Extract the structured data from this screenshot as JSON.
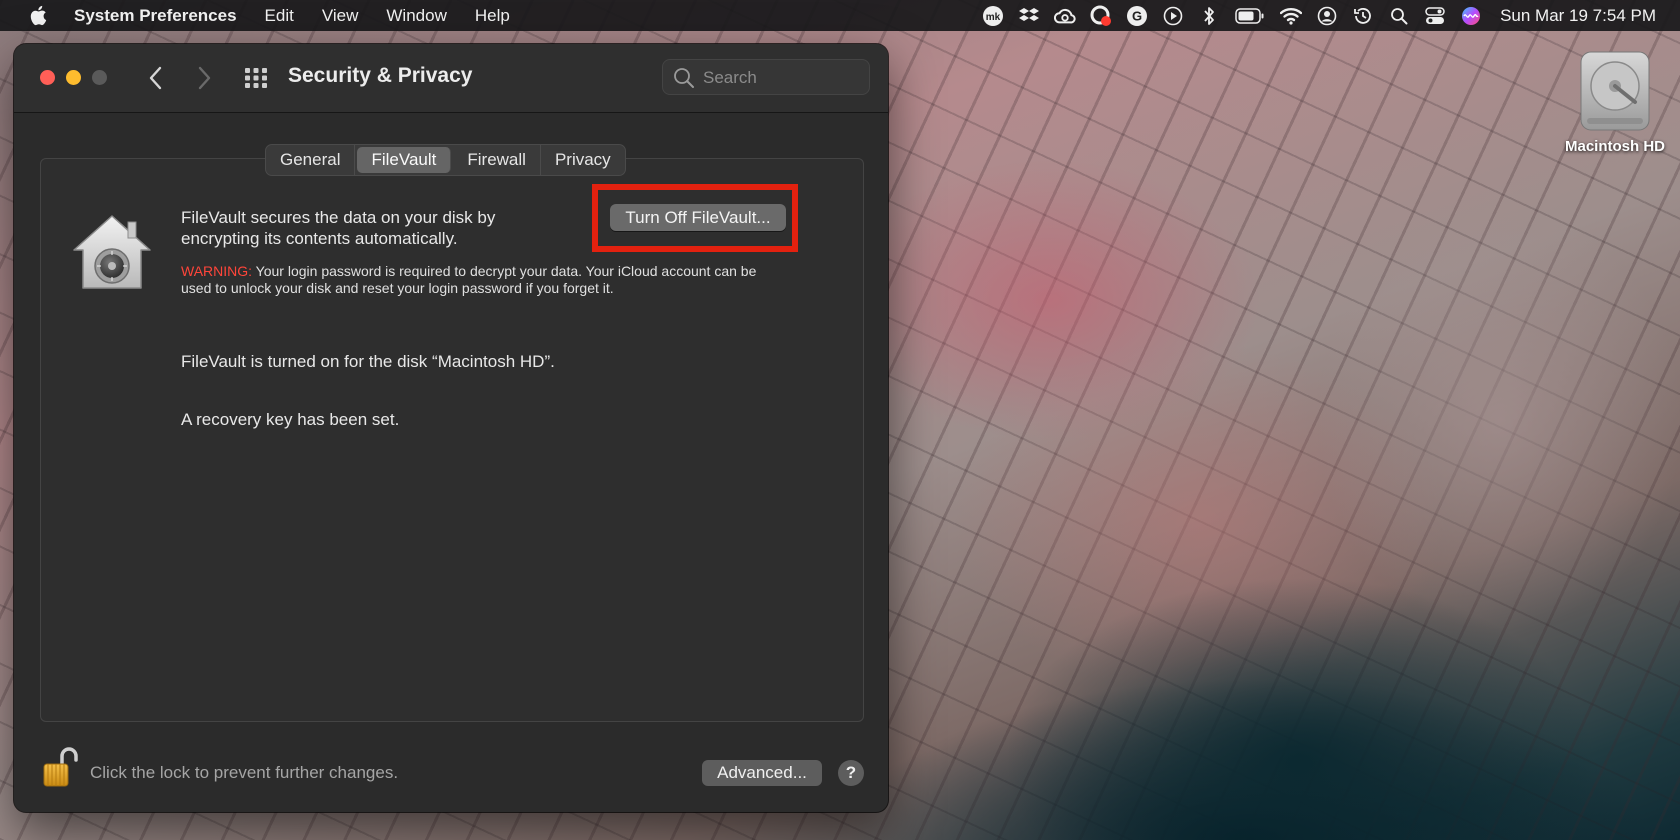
{
  "menubar": {
    "app_name": "System Preferences",
    "menus": [
      "Edit",
      "View",
      "Window",
      "Help"
    ],
    "clock": "Sun Mar 19  7:54 PM",
    "status_icons": [
      "mk-icon",
      "dropbox-icon",
      "creative-cloud-icon",
      "recording-icon",
      "grammarly-icon",
      "play-circle-icon",
      "bluetooth-icon",
      "battery-icon",
      "wifi-icon",
      "user-icon",
      "time-machine-icon",
      "spotlight-search-icon",
      "control-center-icon",
      "siri-icon"
    ]
  },
  "window": {
    "title": "Security & Privacy",
    "search_placeholder": "Search"
  },
  "tabs": [
    {
      "label": "General",
      "active": false
    },
    {
      "label": "FileVault",
      "active": true
    },
    {
      "label": "Firewall",
      "active": false
    },
    {
      "label": "Privacy",
      "active": false
    }
  ],
  "filevault": {
    "description": "FileVault secures the data on your disk by encrypting its contents automatically.",
    "warning_label": "WARNING:",
    "warning_text": " Your login password is required to decrypt your data. Your iCloud account can be used to unlock your disk and reset your login password if you forget it.",
    "turn_off_button": "Turn Off FileVault...",
    "status": "FileVault is turned on for the disk “Macintosh HD”.",
    "recovery": "A recovery key has been set."
  },
  "footer": {
    "lock_text": "Click the lock to prevent further changes.",
    "advanced_button": "Advanced...",
    "help_button": "?"
  },
  "desktop": {
    "disk_label": "Macintosh HD"
  },
  "colors": {
    "highlight_box": "#e3210f",
    "warning": "#ff453a",
    "window_bg": "#2b2b2b"
  }
}
